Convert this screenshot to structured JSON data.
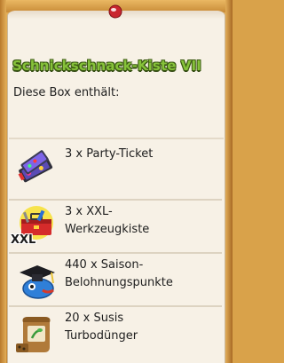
{
  "box": {
    "title": "Schnickschnack-Kiste VII",
    "subtitle": "Diese Box enthält:"
  },
  "items": [
    {
      "line1": "3 x Party-Ticket",
      "line2": "",
      "icon": "party-ticket-icon"
    },
    {
      "line1": "3 x XXL-",
      "line2": "Werkzeugkiste",
      "icon": "xxl-toolbox-icon",
      "badge": "XXL"
    },
    {
      "line1": "440 x Saison-",
      "line2": "Belohnungspunkte",
      "icon": "season-reward-points-icon"
    },
    {
      "line1": "20 x Susis",
      "line2": "Turbodünger",
      "icon": "fertilizer-sack-icon"
    }
  ],
  "colors": {
    "title": "#86c23a",
    "title_outline": "#3c5a14",
    "paper": "#f7f1e6",
    "frame": "#d9a24a"
  }
}
